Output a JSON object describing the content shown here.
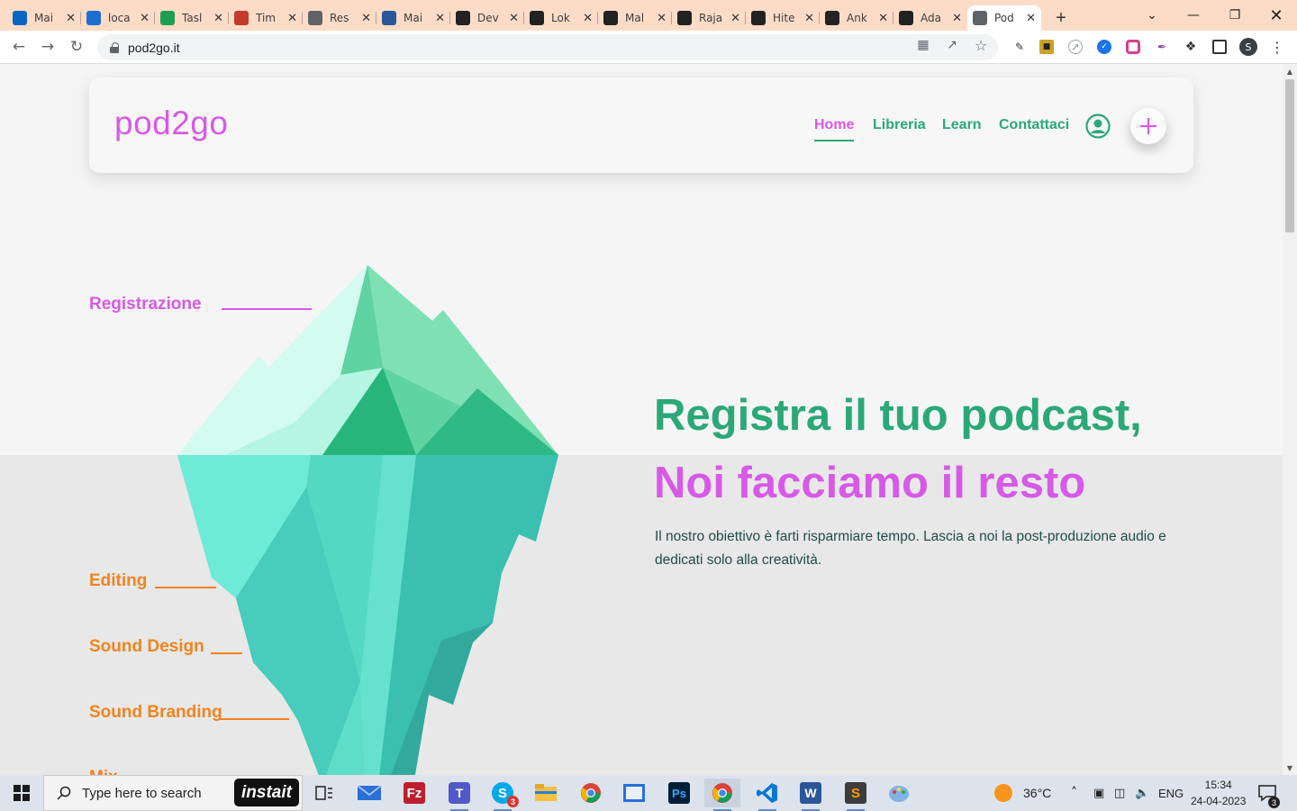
{
  "browser": {
    "tabs": [
      {
        "title": "Mai",
        "icon": "outlook-icon",
        "color": "#0a64c2"
      },
      {
        "title": "loca",
        "icon": "cloud-drive-icon",
        "color": "#1c6fd1"
      },
      {
        "title": "Tasl",
        "icon": "sheets-icon",
        "color": "#1e9d55"
      },
      {
        "title": "Tim",
        "icon": "timesheet-icon",
        "color": "#c23b2a"
      },
      {
        "title": "Res",
        "icon": "globe-icon",
        "color": "#5f6368"
      },
      {
        "title": "Mai",
        "icon": "word-icon",
        "color": "#2b579a"
      },
      {
        "title": "Dev",
        "icon": "invision-icon",
        "color": "#222222"
      },
      {
        "title": "Lok",
        "icon": "invision-icon",
        "color": "#222222"
      },
      {
        "title": "Mal",
        "icon": "invision-icon",
        "color": "#222222"
      },
      {
        "title": "Raja",
        "icon": "invision-icon",
        "color": "#222222"
      },
      {
        "title": "Hite",
        "icon": "invision-icon",
        "color": "#222222"
      },
      {
        "title": "Ank",
        "icon": "invision-icon",
        "color": "#222222"
      },
      {
        "title": "Ada",
        "icon": "invision-icon",
        "color": "#222222"
      },
      {
        "title": "Pod",
        "icon": "globe-icon",
        "color": "#5f6368",
        "active": true
      }
    ],
    "url": "pod2go.it",
    "profile_initial": "S"
  },
  "site": {
    "logo": "pod2go",
    "nav": [
      {
        "label": "Home",
        "active": true
      },
      {
        "label": "Libreria"
      },
      {
        "label": "Learn"
      },
      {
        "label": "Contattaci"
      }
    ],
    "colors": {
      "green": "#2ba877",
      "magenta": "#d65ae6",
      "orange": "#f0841f",
      "text": "#1f4c46"
    }
  },
  "hero": {
    "iceberg_labels": {
      "above": [
        "Registrazione"
      ],
      "below": [
        "Editing",
        "Sound Design",
        "Sound Branding",
        "Mix"
      ]
    },
    "headline_line1": "Registra il tuo podcast,",
    "headline_line2": "Noi facciamo il resto",
    "description": "Il nostro obiettivo è farti risparmiare tempo. Lascia a noi la post-produzione audio e dedicati solo alla creatività."
  },
  "taskbar": {
    "search_placeholder": "Type here to search",
    "instait_label": "instait",
    "weather": "36°C",
    "language": "ENG",
    "time": "15:34",
    "date": "24-04-2023",
    "notifications": "3",
    "skype_badge": "3"
  }
}
